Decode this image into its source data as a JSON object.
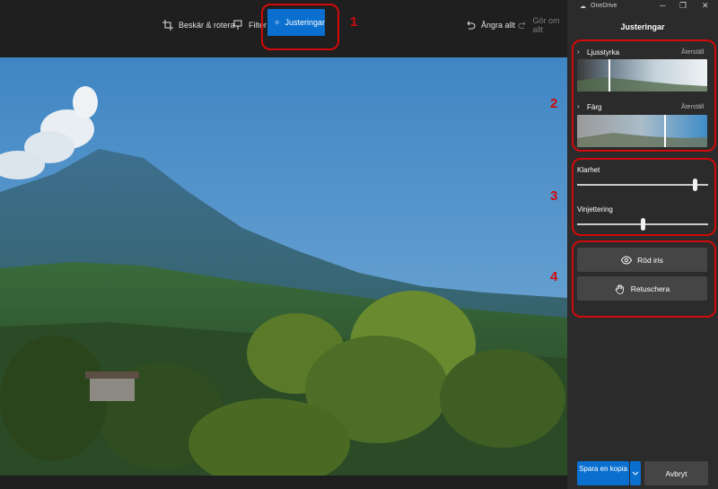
{
  "toolbar": {
    "crop_label": "Beskär & rotera",
    "filter_label": "Filter",
    "adjust_label": "Justeringar",
    "undo_label": "Ångra allt",
    "redo_label": "Gör om allt"
  },
  "window": {
    "app_name": "OneDrive"
  },
  "panel": {
    "title": "Justeringar",
    "light_label": "Ljusstyrka",
    "light_reset": "Återställ",
    "color_label": "Färg",
    "color_reset": "Återställ",
    "clarity_label": "Klarhet",
    "clarity_value": 0.9,
    "vignette_label": "Vinjettering",
    "vignette_value": 0.5,
    "redeye_label": "Röd iris",
    "retouch_label": "Retuschera"
  },
  "footer": {
    "save_label": "Spara en kopia",
    "cancel_label": "Avbryt"
  },
  "annotations": [
    "1",
    "2",
    "3",
    "4"
  ],
  "colors": {
    "accent": "#0a6fcf",
    "annotation": "#d10a0a"
  }
}
